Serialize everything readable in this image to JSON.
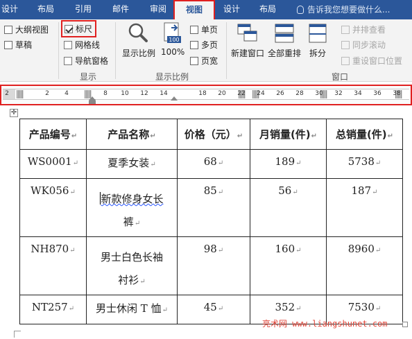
{
  "tabs": [
    {
      "label": "设计"
    },
    {
      "label": "布局"
    },
    {
      "label": "引用"
    },
    {
      "label": "邮件"
    },
    {
      "label": "审阅"
    },
    {
      "label": "视图"
    },
    {
      "label": "设计"
    },
    {
      "label": "布局"
    }
  ],
  "tell_me": "告诉我您想要做什么...",
  "ribbon": {
    "views": {
      "outline": "大纲视图",
      "draft": "草稿"
    },
    "show": {
      "ruler": "标尺",
      "ruler_checked": true,
      "gridlines": "网格线",
      "gridlines_checked": false,
      "nav_pane": "导航窗格",
      "nav_pane_checked": false,
      "group_label": "显示"
    },
    "zoom": {
      "zoom": "显示比例",
      "hundred": "100%",
      "hundred_badge": "100",
      "one_page": "单页",
      "multi_page": "多页",
      "page_width": "页宽",
      "group_label": "显示比例"
    },
    "window": {
      "new_window": "新建窗口",
      "arrange_all": "全部重排",
      "split": "拆分",
      "side_by_side": "并排查看",
      "sync_scroll": "同步滚动",
      "reset_pos": "重设窗口位置",
      "group_label": "窗口"
    }
  },
  "ruler_ticks": [
    "2",
    "2",
    "4",
    "8",
    "10",
    "12",
    "14",
    "18",
    "20",
    "22",
    "24",
    "26",
    "28",
    "30",
    "32",
    "34",
    "36",
    "38"
  ],
  "table": {
    "headers": [
      "产品编号",
      "产品名称",
      "价格（元）",
      "月销量(件)",
      "总销量(件)"
    ],
    "rows": [
      {
        "code": "WS0001",
        "name": "夏季女装",
        "price": "68",
        "monthly": "189",
        "total": "5738"
      },
      {
        "code": "WK056",
        "name_1": "新款修身女长",
        "name_2": "裤",
        "price": "85",
        "monthly": "56",
        "total": "187"
      },
      {
        "code": "NH870",
        "name_1": "男士白色长袖",
        "name_2": "衬衫",
        "price": "98",
        "monthly": "160",
        "total": "8960"
      },
      {
        "code": "NT257",
        "name": "男士休闲 T 恤",
        "price": "45",
        "monthly": "352",
        "total": "7530"
      }
    ]
  },
  "paragraph_mark": "↵",
  "watermark": "亮术网 www.liangshunet.com",
  "colors": {
    "title_bar": "#2b579a",
    "highlight": "#e02020",
    "ribbon_bg": "#f3f3f3",
    "watermark": "#e0463a"
  }
}
